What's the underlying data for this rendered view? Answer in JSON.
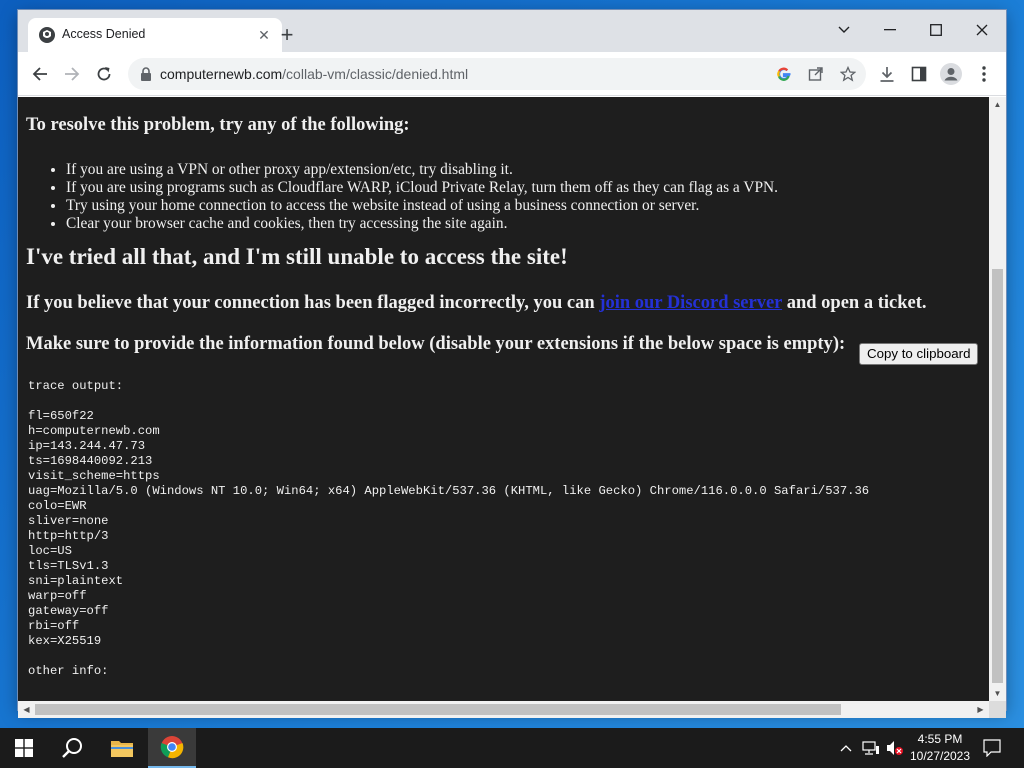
{
  "browser": {
    "tab_title": "Access Denied",
    "url_host": "computernewb.com",
    "url_path": "/collab-vm/classic/denied.html"
  },
  "page": {
    "resolve_heading": "To resolve this problem, try any of the following:",
    "tips": [
      "If you are using a VPN or other proxy app/extension/etc, try disabling it.",
      "If you are using programs such as Cloudflare WARP, iCloud Private Relay, turn them off as they can flag as a VPN.",
      "Try using your home connection to access the website instead of using a business connection or server.",
      "Clear your browser cache and cookies, then try accessing the site again."
    ],
    "still_unable_heading": "I've tried all that, and I'm still unable to access the site!",
    "flagged_prefix": "If you believe that your connection has been flagged incorrectly, you can ",
    "discord_link": "join our Discord server",
    "flagged_suffix": " and open a ticket.",
    "provide_info": "Make sure to provide the information found below (disable your extensions if the below space is empty):",
    "copy_button": "Copy to clipboard",
    "trace_output": "trace output:\n\nfl=650f22\nh=computernewb.com\nip=143.244.47.73\nts=1698440092.213\nvisit_scheme=https\nuag=Mozilla/5.0 (Windows NT 10.0; Win64; x64) AppleWebKit/537.36 (KHTML, like Gecko) Chrome/116.0.0.0 Safari/537.36\ncolo=EWR\nsliver=none\nhttp=http/3\nloc=US\ntls=TLSv1.3\nsni=plaintext\nwarp=off\ngateway=off\nrbi=off\nkex=X25519\n\nother info:"
  },
  "taskbar": {
    "time": "4:55 PM",
    "date": "10/27/2023"
  },
  "colors": {
    "page_background": "#1e1e1e",
    "link": "#2431d6",
    "taskbar": "#1b1b1b",
    "desktop": "#1c7fd8"
  },
  "icons": [
    "shield-favicon-icon",
    "close-icon",
    "plus-icon",
    "chevron-down-icon",
    "minimize-icon",
    "maximize-icon",
    "window-close-icon",
    "back-arrow-icon",
    "forward-arrow-icon",
    "reload-icon",
    "lock-icon",
    "google-icon",
    "share-icon",
    "star-icon",
    "download-icon",
    "side-panel-icon",
    "profile-icon",
    "kebab-menu-icon",
    "windows-start-icon",
    "search-icon",
    "file-explorer-icon",
    "chrome-icon",
    "chevron-up-icon",
    "network-icon",
    "volume-icon",
    "notification-icon"
  ]
}
